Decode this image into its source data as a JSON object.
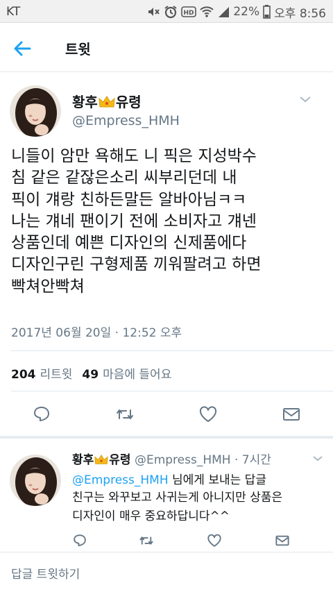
{
  "status_bar": {
    "carrier": "KT",
    "battery": "22%",
    "time": "오후 8:56",
    "icons": [
      "mute-icon",
      "alarm-icon",
      "hd-icon",
      "wifi-icon",
      "signal-icon",
      "battery-icon"
    ]
  },
  "header": {
    "back_icon": "arrow-left-icon",
    "title": "트윗"
  },
  "main_tweet": {
    "display_name_prefix": "황후",
    "display_name_suffix": "유령",
    "handle": "@Empress_HMH",
    "text": "니들이 암만 욕해도 니 픽은 지성박수\n침 같은 같잖은소리 씨부리던데 내\n픽이 걔랑 친하든말든 알바아님ㅋㅋ\n나는 걔네 팬이기 전에 소비자고 걔넨\n상품인데 예쁜 디자인의 신제품에다\n디자인구린 구형제품 끼워팔려고 하면\n빡쳐안빡쳐",
    "timestamp": "2017년 06월 20일 · 12:52 오후",
    "retweet_count": "204",
    "retweet_label": "리트윗",
    "like_count": "49",
    "like_label": "마음에 들어요"
  },
  "reply_tweet": {
    "display_name_prefix": "황후",
    "display_name_suffix": "유령",
    "handle": "@Empress_HMH",
    "time_ago": " · 7시간",
    "reply_to_handle": "@Empress_HMH",
    "reply_to_suffix": " 님에게 보내는 답글",
    "text": "친구는 와꾸보고 사귀는게 아니지만 상품은\n디자인이 매우 중요하답니다^^"
  },
  "compose": {
    "placeholder": "답글 트윗하기"
  },
  "colors": {
    "accent": "#1da1f2",
    "muted": "#657786",
    "text": "#14171a",
    "divider": "#e1e8ed"
  }
}
